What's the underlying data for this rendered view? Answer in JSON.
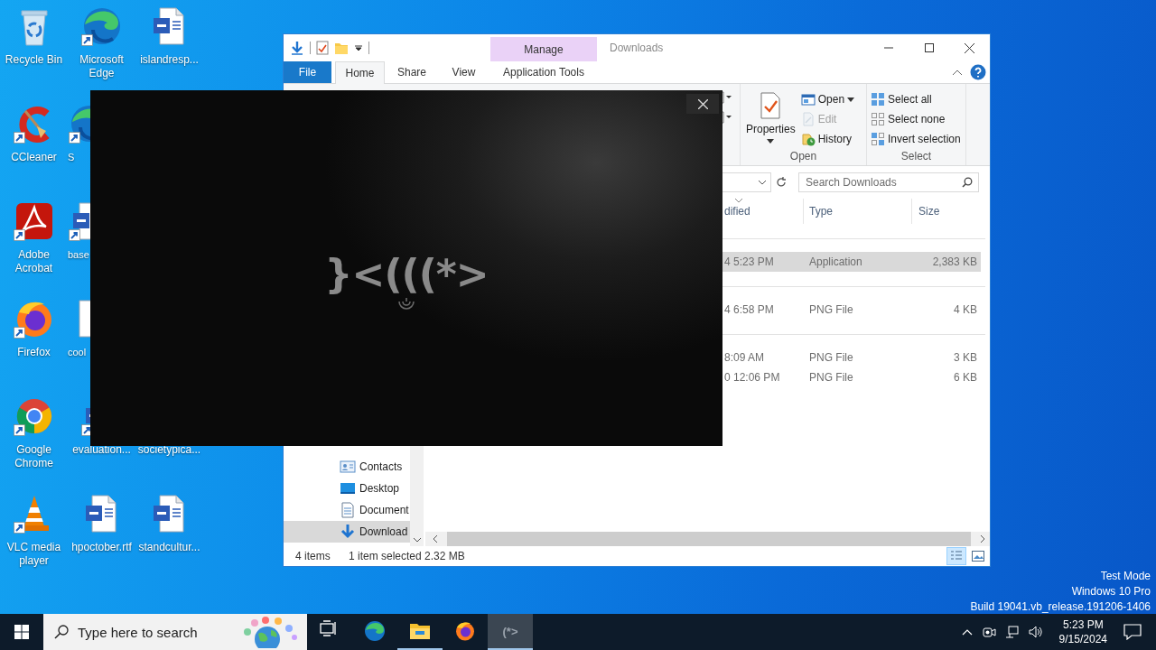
{
  "desktop": {
    "columns": [
      [
        {
          "label": "Recycle Bin",
          "kind": "recycle",
          "shortcut": false
        },
        {
          "label": "CCleaner",
          "kind": "ccleaner",
          "shortcut": true
        },
        {
          "label": "Adobe Acrobat",
          "kind": "acrobat",
          "shortcut": true
        },
        {
          "label": "Firefox",
          "kind": "firefox",
          "shortcut": true
        },
        {
          "label": "Google Chrome",
          "kind": "chrome",
          "shortcut": true
        },
        {
          "label": "VLC media player",
          "kind": "vlc",
          "shortcut": true
        }
      ],
      [
        {
          "label": "Microsoft Edge",
          "kind": "edge",
          "shortcut": true
        },
        {
          "label": "S",
          "kind": "edge",
          "shortcut": true
        },
        {
          "label": "base",
          "kind": "word",
          "shortcut": true
        },
        {
          "label": "cool",
          "kind": "doc",
          "shortcut": false
        },
        {
          "label": "evaluation...",
          "kind": "word",
          "shortcut": true
        },
        {
          "label": "hpoctober.rtf",
          "kind": "word",
          "shortcut": false
        }
      ],
      [
        {
          "label": "islandresp...",
          "kind": "word",
          "shortcut": false
        },
        {
          "label": "societypica..."
        },
        {
          "label": "standcultur...",
          "kind": "word",
          "shortcut": false
        }
      ]
    ]
  },
  "explorer": {
    "title": "Downloads",
    "context_tab": "Manage",
    "tabs": [
      {
        "label": "File",
        "kind": "file",
        "selected": false
      },
      {
        "label": "Home",
        "selected": true
      },
      {
        "label": "Share",
        "selected": false
      },
      {
        "label": "View",
        "selected": false
      },
      {
        "label": "Application Tools",
        "kind": "context",
        "selected": false
      }
    ],
    "ribbon_groups": [
      {
        "label": "Open",
        "large": {
          "label": "Properties",
          "dropdown": true
        },
        "items": [
          {
            "label": "Open",
            "dropdown": true,
            "disabled": false
          },
          {
            "label": "Edit",
            "dropdown": false,
            "disabled": true
          },
          {
            "label": "History",
            "dropdown": false,
            "disabled": false
          }
        ]
      },
      {
        "label": "Select",
        "items": [
          {
            "label": "Select all",
            "dropdown": false,
            "disabled": false
          },
          {
            "label": "Select none",
            "dropdown": false,
            "disabled": false
          },
          {
            "label": "Invert selection",
            "dropdown": false,
            "disabled": false
          }
        ]
      }
    ],
    "search": {
      "placeholder": "Search Downloads"
    },
    "columns": [
      "dified",
      "Type",
      "Size"
    ],
    "groups": [
      {
        "rows": [
          {
            "date": "4 5:23 PM",
            "type": "Application",
            "size": "2,383 KB",
            "selected": true
          }
        ]
      },
      {
        "rows": [
          {
            "date": "4 6:58 PM",
            "type": "PNG File",
            "size": "4 KB",
            "selected": false
          }
        ]
      },
      {
        "rows": [
          {
            "date": "8:09 AM",
            "type": "PNG File",
            "size": "3 KB",
            "selected": false
          },
          {
            "date": "0 12:06 PM",
            "type": "PNG File",
            "size": "6 KB",
            "selected": false
          }
        ]
      }
    ],
    "nav": [
      {
        "label": "Contacts",
        "selected": false
      },
      {
        "label": "Desktop",
        "selected": false
      },
      {
        "label": "Document",
        "selected": false
      },
      {
        "label": "Download",
        "selected": true
      }
    ],
    "status": {
      "count": "4 items",
      "selection": "1 item selected",
      "size": "2.32 MB"
    }
  },
  "splash": {
    "logo": "}<(((*>"
  },
  "os_info": [
    "Test Mode",
    "Windows 10 Pro",
    "Build 19041.vb_release.191206-1406"
  ],
  "taskbar": {
    "search": {
      "placeholder": "Type here to search"
    },
    "apps": [
      {
        "kind": "taskview",
        "running": false,
        "selected": false
      },
      {
        "kind": "edge",
        "running": false,
        "selected": false
      },
      {
        "kind": "explorer",
        "running": true,
        "selected": false
      },
      {
        "kind": "firefox",
        "running": false,
        "selected": false
      },
      {
        "kind": "app",
        "label": "(*>",
        "running": true,
        "selected": true
      }
    ],
    "time": "5:23 PM",
    "date": "9/15/2024"
  }
}
